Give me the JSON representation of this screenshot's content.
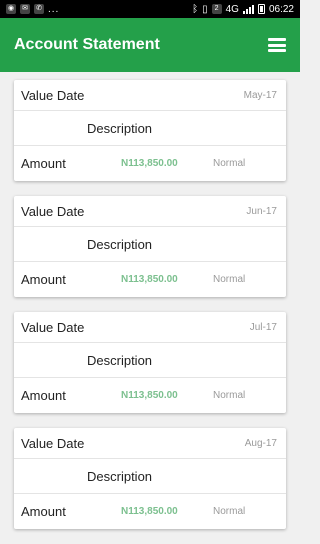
{
  "status_bar": {
    "left_icons": [
      "notification-icon-1",
      "notification-icon-2",
      "phone-icon"
    ],
    "overflow": "...",
    "right_icons": [
      "bluetooth-icon",
      "vibrate-icon",
      "sim-icon",
      "network-icon",
      "signal-icon",
      "battery-icon"
    ],
    "time": "06:22"
  },
  "appbar": {
    "title": "Account Statement",
    "menu_icon": "hamburger-menu-icon"
  },
  "colors": {
    "primary": "#24a04a",
    "amount": "#7cc08f",
    "muted": "#9a9a9a"
  },
  "statements": [
    {
      "value_date_label": "Value Date",
      "date": "May-17",
      "description_label": "Description",
      "amount_label": "Amount",
      "amount": "N113,850.00",
      "status": "Normal"
    },
    {
      "value_date_label": "Value Date",
      "date": "Jun-17",
      "description_label": "Description",
      "amount_label": "Amount",
      "amount": "N113,850.00",
      "status": "Normal"
    },
    {
      "value_date_label": "Value Date",
      "date": "Jul-17",
      "description_label": "Description",
      "amount_label": "Amount",
      "amount": "N113,850.00",
      "status": "Normal"
    },
    {
      "value_date_label": "Value Date",
      "date": "Aug-17",
      "description_label": "Description",
      "amount_label": "Amount",
      "amount": "N113,850.00",
      "status": "Normal"
    }
  ]
}
